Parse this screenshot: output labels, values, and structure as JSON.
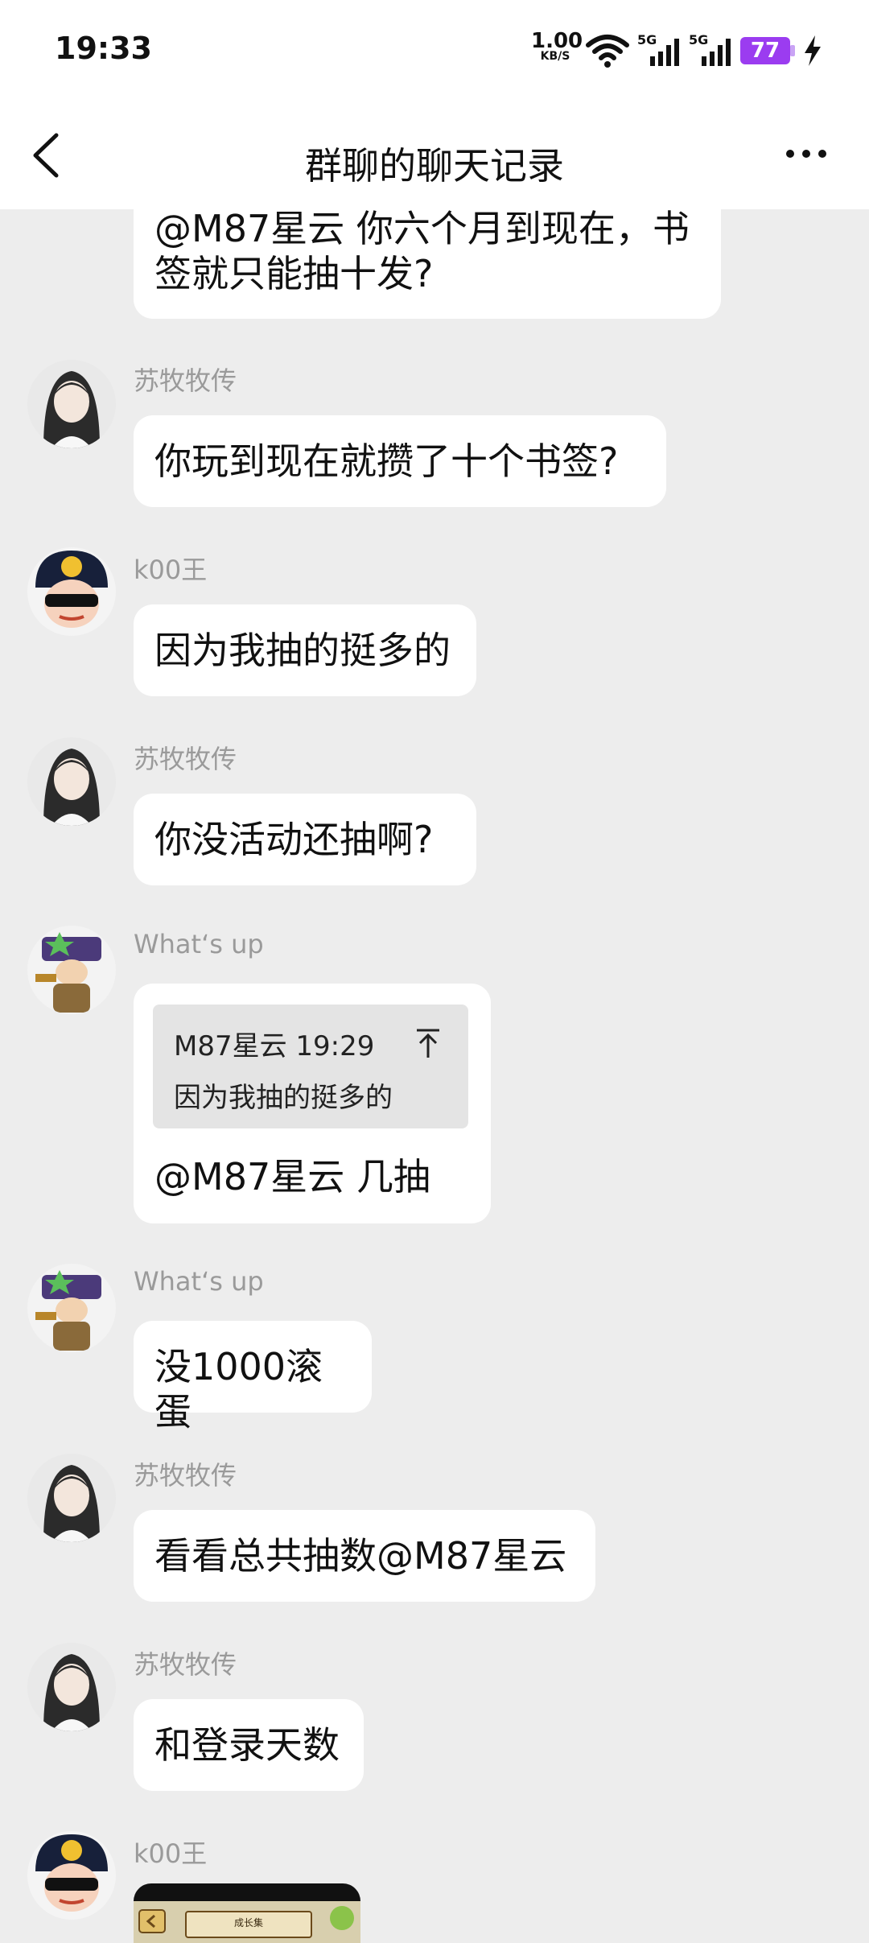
{
  "status": {
    "time": "19:33",
    "net_speed_value": "1.00",
    "net_speed_unit": "KB/S",
    "signal1_label": "5G",
    "signal2_label": "5G",
    "battery": "77",
    "colors": {
      "battery": "#9b3cf0"
    }
  },
  "header": {
    "title": "群聊的聊天记录",
    "back_icon": "chevron-left-icon",
    "more_icon": "more-horizontal-icon"
  },
  "messages": [
    {
      "sender": "",
      "text": "@M87星云 你六个月到现在，书\n签就只能抽十发?"
    },
    {
      "sender": "苏牧牧传",
      "text": "你玩到现在就攒了十个书签?"
    },
    {
      "sender": "k00王",
      "text": "因为我抽的挺多的"
    },
    {
      "sender": "苏牧牧传",
      "text": "你没活动还抽啊?"
    },
    {
      "sender": "What‘s up",
      "quote_header": "M87星云 19:29",
      "quote_text": "因为我抽的挺多的",
      "text": "@M87星云 几抽"
    },
    {
      "sender": "What‘s up",
      "text": "没1000滚蛋"
    },
    {
      "sender": "苏牧牧传",
      "text": "看看总共抽数@M87星云"
    },
    {
      "sender": "苏牧牧传",
      "text": "和登录天数"
    },
    {
      "sender": "k00王",
      "image_caption": "成长集"
    }
  ]
}
